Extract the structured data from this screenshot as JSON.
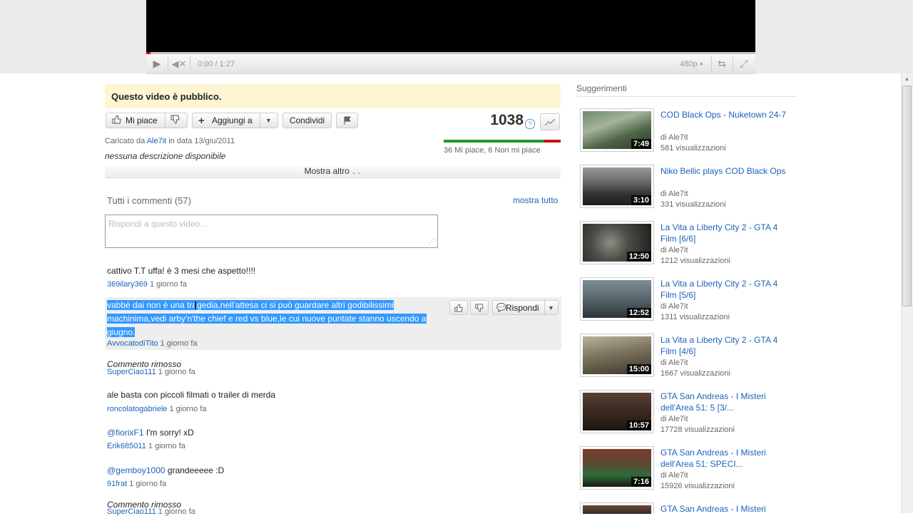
{
  "player": {
    "time": "0:00 / 1:27",
    "quality": "480p"
  },
  "video": {
    "public_notice": "Questo video è pubblico.",
    "like_label": "Mi piace",
    "add_label": "Aggiungi a",
    "share_label": "Condividi",
    "views": "1038",
    "likes_text": "36 Mi piace, 6 Non mi piace",
    "uploaded_prefix": "Caricato da",
    "uploader": "Ale7it",
    "uploaded_suffix": "in data 13/giu/2011",
    "description": "nessuna descrizione disponibile",
    "show_more": "Mostra altro",
    "likes_fraction": 0.857
  },
  "comments": {
    "title": "Tutti i commenti (57)",
    "show_all": "mostra tutto",
    "placeholder": "Rispondi a questo video...",
    "reply_label": "Rispondi",
    "items": [
      {
        "text": "cattivo T.T uffa! è 3 mesi che aspetto!!!!",
        "author": "369ilary369",
        "time": "1 giorno fa"
      },
      {
        "text": "vabbè dai non è una tragedia,nell'attesa ci si può guardare altri godibilissimi machinima,vedi arby'n'the chief e red vs blue,le cui nuove puntate stanno uscendo a giugno.",
        "author": "AvvocatodiTito",
        "time": "1 giorno fa"
      },
      {
        "text": "Commento rimosso",
        "author": "SuperCiao111",
        "time": "1 giorno fa"
      },
      {
        "text": "ale basta con piccoli filmati o trailer di merda",
        "author": "roncolatogabriele",
        "time": "1 giorno fa"
      },
      {
        "mention": "@fiorixF1",
        "text": " I'm sorry! xD",
        "author": "Erik685011",
        "time": "1 giorno fa"
      },
      {
        "mention": "@gemboy1000",
        "text": " grandeeeee :D",
        "author": "91frat",
        "time": "1 giorno fa"
      },
      {
        "text": "Commento rimosso",
        "author": "SuperCiao111",
        "time": "1 giorno fa"
      }
    ]
  },
  "sidebar": {
    "title": "Suggerimenti",
    "items": [
      {
        "title": "COD Black Ops - Nuketown 24-7",
        "by": "di Ale7it",
        "views": "581 visualizzazioni",
        "duration": "7:49"
      },
      {
        "title": "Niko Bellic plays COD Black Ops",
        "by": "di Ale7it",
        "views": "331 visualizzazioni",
        "duration": "3:10"
      },
      {
        "title": "La Vita a Liberty City 2 - GTA 4 Film [6/6]",
        "by": "di Ale7it",
        "views": "1212 visualizzazioni",
        "duration": "12:50"
      },
      {
        "title": "La Vita a Liberty City 2 - GTA 4 Film [5/6]",
        "by": "di Ale7it",
        "views": "1311 visualizzazioni",
        "duration": "12:52"
      },
      {
        "title": "La Vita a Liberty City 2 - GTA 4 Film [4/6]",
        "by": "di Ale7it",
        "views": "1667 visualizzazioni",
        "duration": "15:00"
      },
      {
        "title": "GTA San Andreas - I Misteri dell'Area 51: 5 [3/...",
        "by": "di Ale7it",
        "views": "17728 visualizzazioni",
        "duration": "10:57"
      },
      {
        "title": "GTA San Andreas - I Misteri dell'Area 51: SPECI...",
        "by": "di Ale7it",
        "views": "15926 visualizzazioni",
        "duration": "7:16"
      },
      {
        "title": "GTA San Andreas - I Misteri",
        "by": "",
        "views": "",
        "duration": ""
      }
    ]
  }
}
